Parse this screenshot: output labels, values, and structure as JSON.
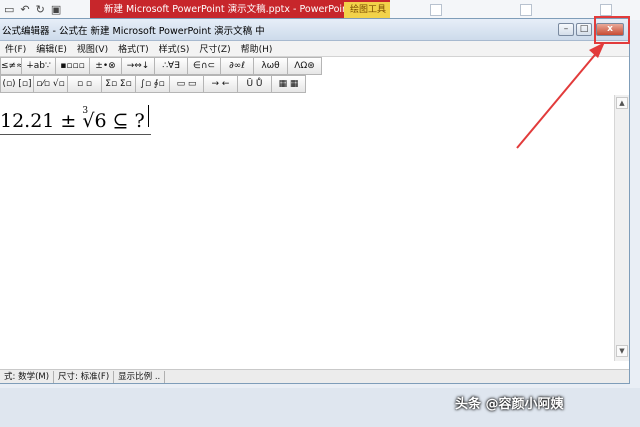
{
  "ppt": {
    "title": "新建 Microsoft PowerPoint 演示文稿.pptx - PowerPoint...",
    "contextual_tab": "绘图工具"
  },
  "editor": {
    "title": "公式编辑器 - 公式在 新建 Microsoft PowerPoint 演示文稿 中",
    "menu": [
      "件(F)",
      "编辑(E)",
      "视图(V)",
      "格式(T)",
      "样式(S)",
      "尺寸(Z)",
      "帮助(H)"
    ],
    "toolbar_row1": [
      "≤≠≈",
      "∔ab∵",
      "▪▫▫▫",
      "±•⊗",
      "→⇔↓",
      "∴∀∃",
      "∈∩⊂",
      "∂∞ℓ",
      "λωθ",
      "ΛΩ⊛"
    ],
    "toolbar_row2": [
      "(▫) [▫]",
      "▫⁄▫ √▫",
      "▫ ▫",
      "Σ▫ Σ▫",
      "∫▫ ∮▫",
      "▭ ▭",
      "→ ←",
      "Ū Ů",
      "▦ ▦"
    ],
    "equation": {
      "number": "12.21",
      "plus_minus": "±",
      "root_index": "3",
      "root_sign": "√",
      "radicand": "6",
      "relation": "⊆",
      "placeholder": "?"
    },
    "status": [
      "式: 数学(M)",
      "尺寸: 标准(F)",
      "显示比例 .."
    ]
  },
  "watermark": "头条 @容颜小阿姨",
  "annotation_color": "#e23b3b"
}
